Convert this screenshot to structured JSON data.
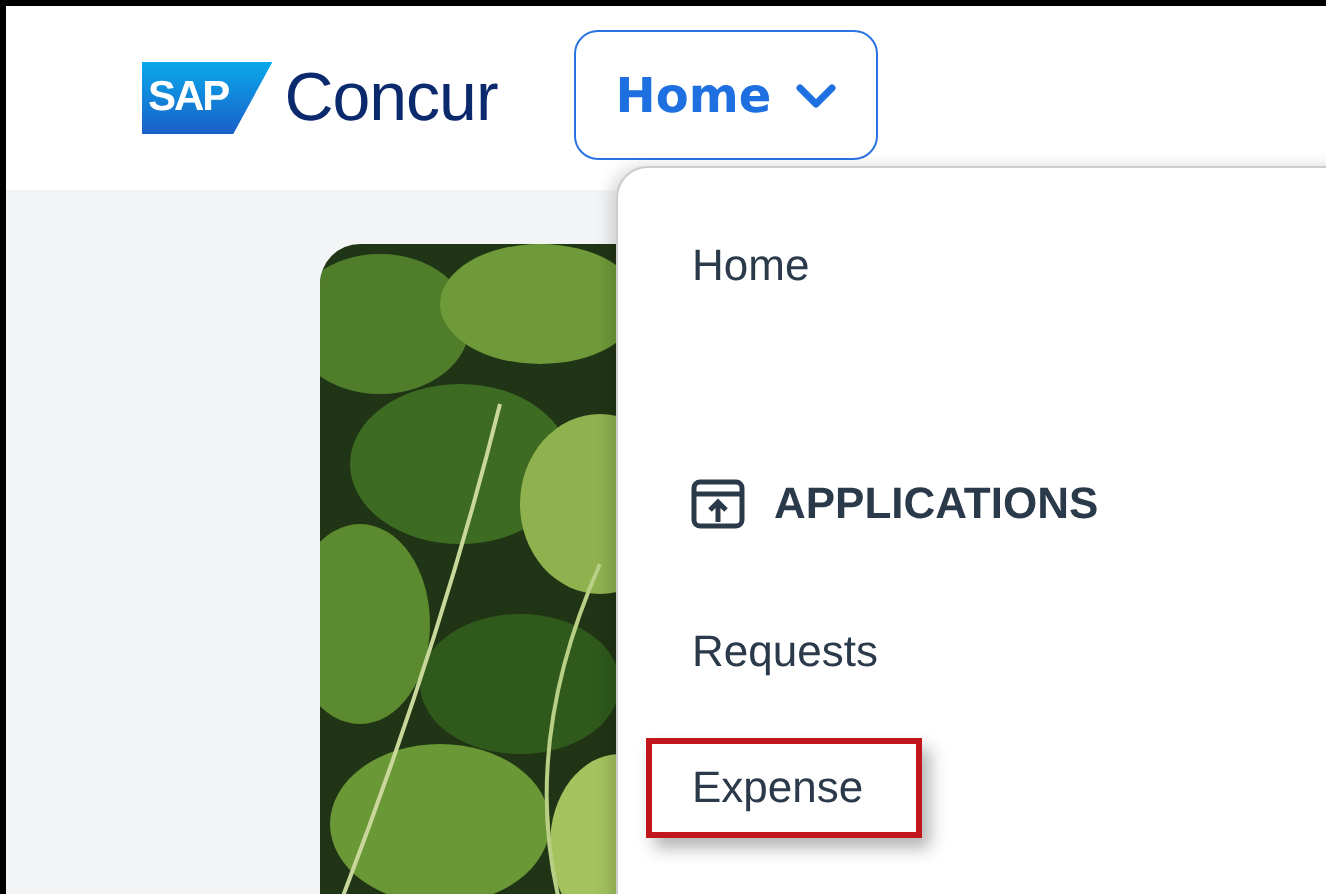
{
  "header": {
    "logo": {
      "mark": "SAP",
      "name": "Concur"
    },
    "nav_button": {
      "label": "Home",
      "expanded": true
    }
  },
  "menu": {
    "items": [
      {
        "kind": "link",
        "label": "Home",
        "highlighted": false
      },
      {
        "kind": "section",
        "label": "APPLICATIONS"
      },
      {
        "kind": "link",
        "label": "Requests",
        "highlighted": false
      },
      {
        "kind": "link",
        "label": "Expense",
        "highlighted": true
      }
    ]
  }
}
